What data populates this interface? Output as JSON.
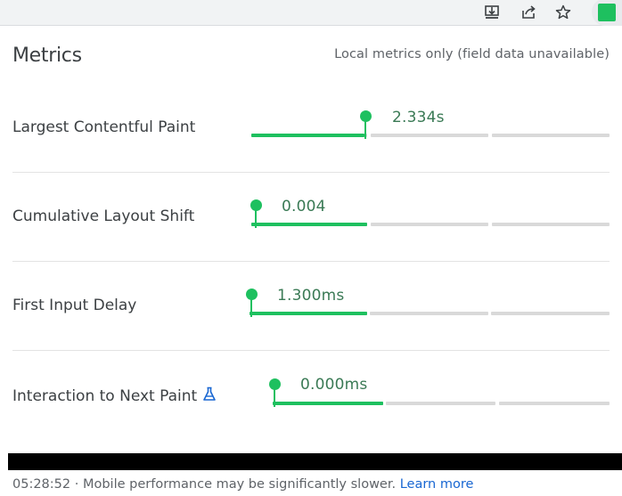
{
  "toolbar": {
    "icons": [
      "download-icon",
      "share-icon",
      "star-icon"
    ],
    "extension_color": "#1ec05f"
  },
  "header": {
    "title": "Metrics",
    "subtitle": "Local metrics only (field data unavailable)"
  },
  "metrics": [
    {
      "label": "Largest Contentful Paint",
      "value": "2.334s",
      "rating": "good",
      "has_experimental_icon": false
    },
    {
      "label": "Cumulative Layout Shift",
      "value": "0.004",
      "rating": "good",
      "has_experimental_icon": false
    },
    {
      "label": "First Input Delay",
      "value": "1.300ms",
      "rating": "good",
      "has_experimental_icon": false
    },
    {
      "label": "Interaction to Next Paint",
      "value": "0.000ms",
      "rating": "good",
      "has_experimental_icon": true
    }
  ],
  "colors": {
    "good": "#1ec05f",
    "track": "#d9d9d9",
    "value_text": "#3a7a55",
    "link": "#1967d2"
  },
  "footer": {
    "timestamp": "05:28:52",
    "separator": " · ",
    "message": "Mobile performance may be significantly slower.",
    "link_text": "Learn more"
  }
}
